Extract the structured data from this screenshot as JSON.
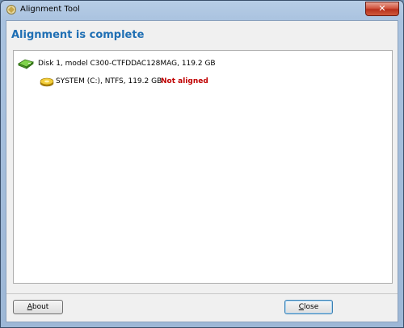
{
  "window": {
    "title": "Alignment Tool",
    "close_glyph": "✕"
  },
  "heading": "Alignment is complete",
  "tree": {
    "disk": {
      "label": "Disk 1, model C300-CTFDDAC128MAG, 119.2 GB",
      "icon": "disk-icon"
    },
    "partition": {
      "label": "SYSTEM (C:), NTFS, 119.2 GB",
      "status": "Not aligned",
      "icon": "partition-icon"
    }
  },
  "buttons": {
    "about": {
      "label": "About",
      "mnemonic": "A",
      "rest": "bout"
    },
    "close": {
      "label": "Close",
      "mnemonic": "C",
      "rest": "lose"
    }
  },
  "colors": {
    "heading": "#1f6fb4",
    "status": "#c00000",
    "disk_icon": "#5ab232",
    "partition_icon": "#e0b000"
  }
}
